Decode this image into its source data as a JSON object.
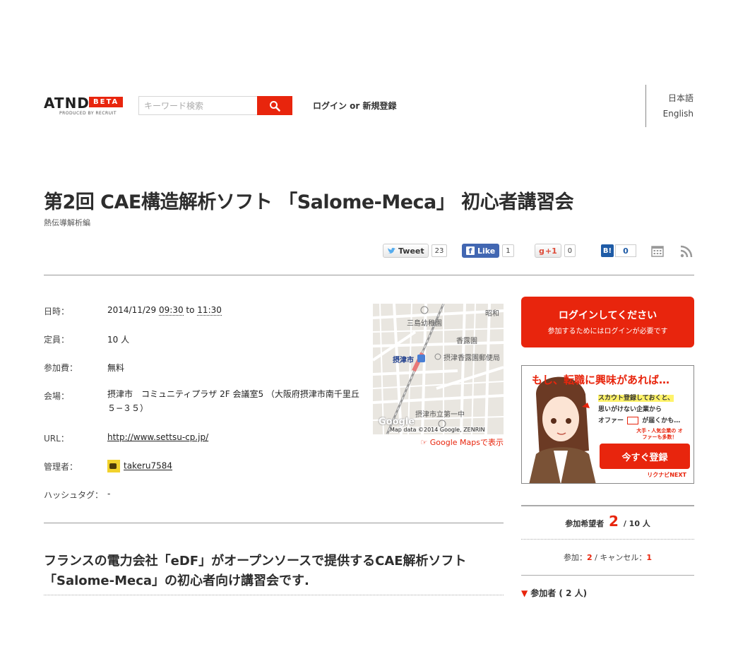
{
  "header": {
    "logo_text": "ATND",
    "logo_badge": "BETA",
    "logo_sub": "PRODUCED BY RECRUIT",
    "search_placeholder": "キーワード検索",
    "auth_label": "ログイン or 新規登録",
    "lang_ja": "日本語",
    "lang_en": "English"
  },
  "event": {
    "title": "第2回 CAE構造解析ソフト 「Salome-Meca」 初心者講習会",
    "subtitle": "熱伝導解析編"
  },
  "share": {
    "tweet_label": "Tweet",
    "tweet_count": "23",
    "like_label": "Like",
    "like_count": "1",
    "gplus_label": "+1",
    "gplus_count": "0",
    "hatena_label": "B!",
    "hatena_count": "0"
  },
  "details": {
    "date_label": "日時：",
    "date_day": "2014/11/29",
    "date_start": "09:30",
    "date_to": "to",
    "date_end": "11:30",
    "capacity_label": "定員：",
    "capacity_value": "10 人",
    "fee_label": "参加費：",
    "fee_value": "無料",
    "venue_label": "会場：",
    "venue_value": "摂津市　コミュニティプラザ 2F 会議室5 （大阪府摂津市南千里丘５−３５）",
    "url_label": "URL：",
    "url_value": "http://www.settsu-cp.jp/",
    "admin_label": "管理者：",
    "admin_value": "takeru7584",
    "hashtag_label": "ハッシュタグ：",
    "hashtag_value": "-"
  },
  "map": {
    "label_kindergarten": "三島幼稚園",
    "label_showa": "昭和",
    "label_koroen": "香露園",
    "label_station": "摂津市",
    "label_post": "摂津香露園郵便局",
    "label_school": "摂津市立第一中",
    "google": "Google",
    "attribution": "Map data ©2014 Google, ZENRIN",
    "link_label": "☞ Google Mapsで表示"
  },
  "description": {
    "line1": "フランスの電力会社「eDF」がオープンソースで提供するCAE解析ソフト",
    "line2": "「Salome-Meca」の初心者向け講習会です."
  },
  "sidebar": {
    "login_title": "ログインしてください",
    "login_sub": "参加するためにはログインが必要です",
    "ad_title": "もし、転職に興味があれば…",
    "ad_line1": "スカウト登録しておくと、",
    "ad_line2": "思いがけない企業から",
    "ad_line3": "オファー",
    "ad_line3b": "が届くかも…",
    "ad_bubble": "大手・人気企業の オファーも多数！",
    "ad_button": "今すぐ登録",
    "ad_logo": "リクナビNEXT",
    "applicants_label": "参加希望者",
    "applicants_count": "2",
    "applicants_capacity": "/ 10 人",
    "join_label": "参加：",
    "join_count": "2",
    "cancel_label": "/ キャンセル：",
    "cancel_count": "1",
    "participants_label": "参加者 ( 2 人)"
  },
  "colors": {
    "accent": "#e8250d",
    "facebook": "#4267b2",
    "hatena": "#1e5ba6"
  }
}
